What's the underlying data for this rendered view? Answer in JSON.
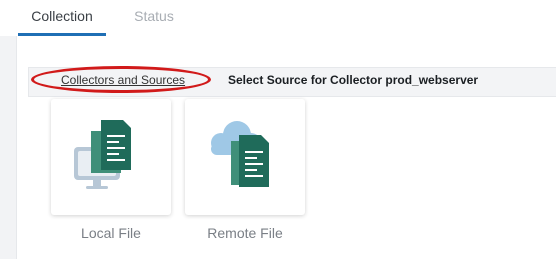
{
  "tabs": [
    {
      "label": "Collection",
      "active": true
    },
    {
      "label": "Status",
      "active": false
    }
  ],
  "breadcrumb": {
    "link": "Collectors and Sources",
    "title": "Select Source for Collector prod_webserver"
  },
  "sources": [
    {
      "label": "Local File",
      "icon": "local-file-icon"
    },
    {
      "label": "Remote File",
      "icon": "remote-file-icon"
    }
  ],
  "colors": {
    "tab_active_underline": "#1f6fb5",
    "annotation_red": "#d11a1a",
    "doc_green": "#1f6b5a",
    "monitor_blue": "#b7c7d6",
    "cloud_blue": "#9fc8e6"
  }
}
